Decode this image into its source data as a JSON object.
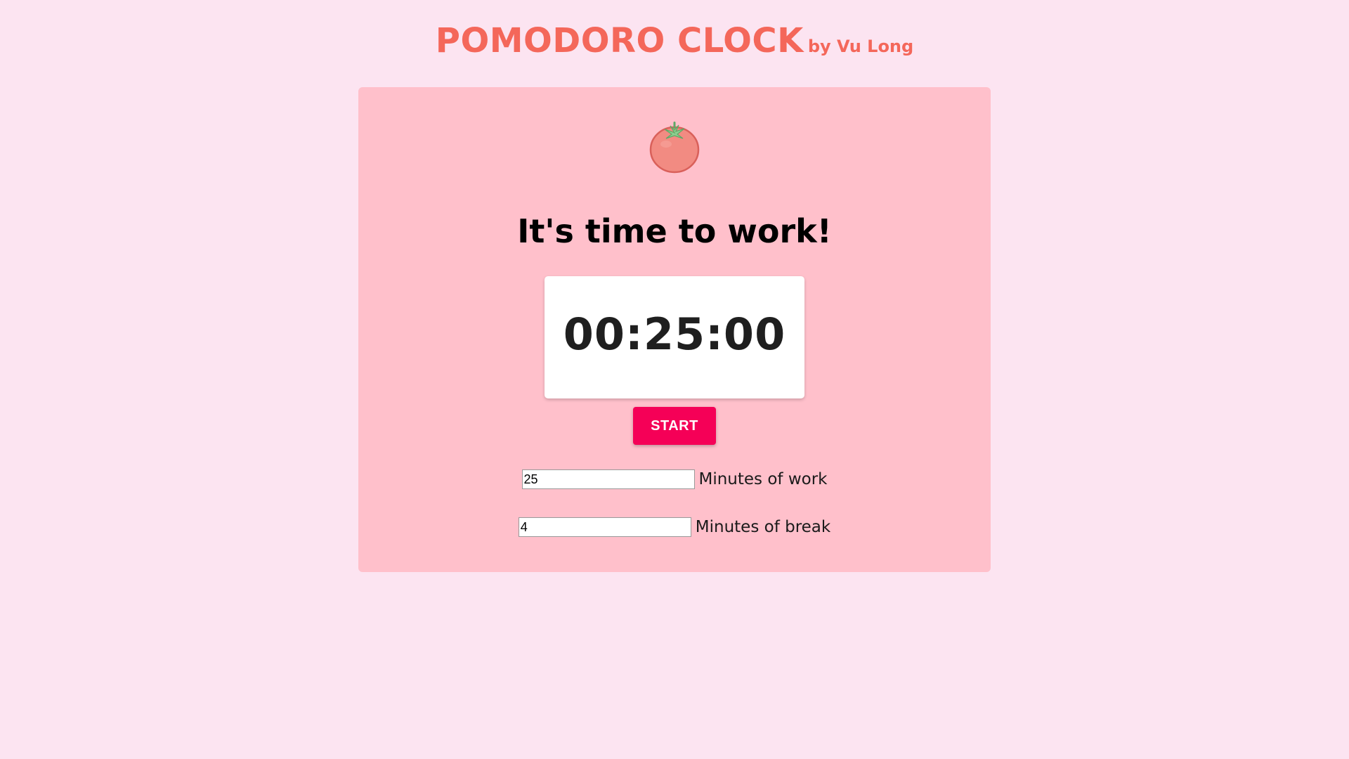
{
  "header": {
    "title": "POMODORO CLOCK",
    "byline": "by Vu Long"
  },
  "main": {
    "icon": "tomato-icon",
    "heading": "It's time to work!",
    "timer": "00:25:00",
    "start_label": "START",
    "work_field": {
      "value": "25",
      "label": "Minutes of work"
    },
    "break_field": {
      "value": "4",
      "label": "Minutes of break"
    }
  },
  "colors": {
    "background": "#fce4f1",
    "card": "#ffc0cb",
    "title": "#f4675a",
    "start_button": "#f50057"
  }
}
